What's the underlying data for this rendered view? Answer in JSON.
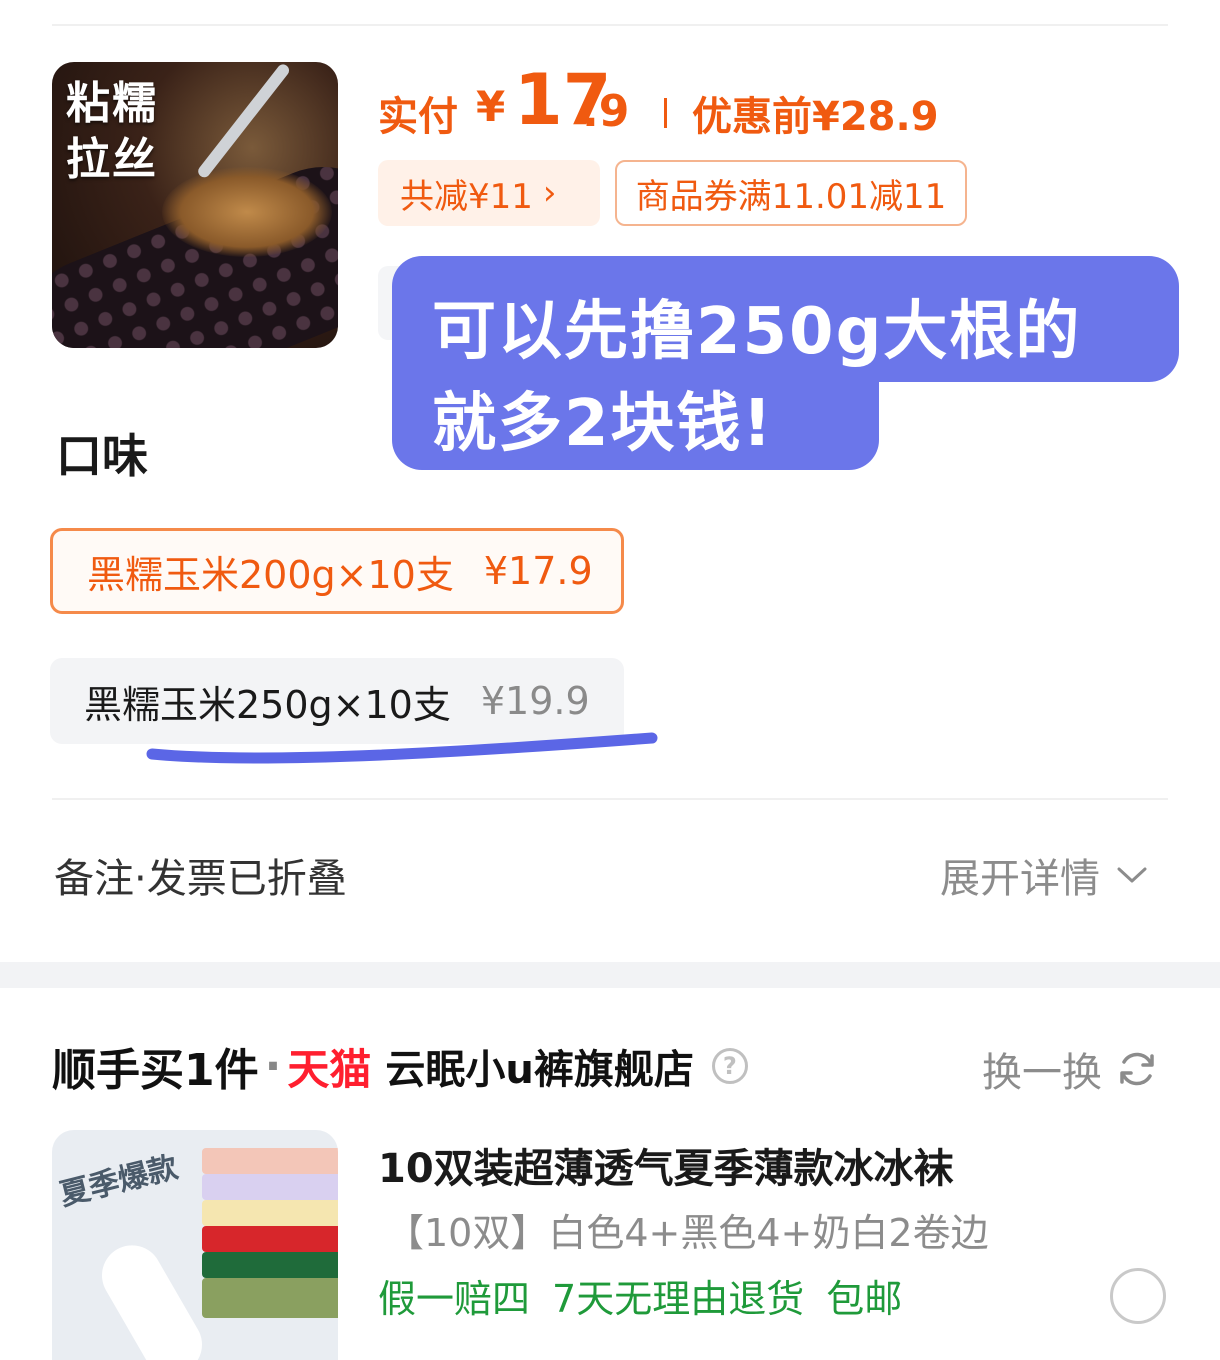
{
  "product": {
    "image_caption_line1": "粘糯",
    "image_caption_line2": "拉丝",
    "pay_label": "实付",
    "currency": "¥",
    "pay_int": "17",
    "pay_dec": ".9",
    "original_price_label": "优惠前¥28.9",
    "saved_chip": "共减¥11",
    "saved_chevron": "›",
    "coupon_chip": "商品券满11.01减11"
  },
  "annotation": {
    "line1": "可以先撸250g大根的",
    "line2": "就多2块钱!",
    "bubble_color": "#6b76ea",
    "underline_color": "#5b66e6"
  },
  "flavor": {
    "title": "口味",
    "options": [
      {
        "label": "黑糯玉米200g×10支",
        "price": "¥17.9",
        "selected": true
      },
      {
        "label": "黑糯玉米250g×10支",
        "price": "¥19.9",
        "selected": false
      }
    ]
  },
  "notes": {
    "label": "备注·发票已折叠",
    "expand_label": "展开详情",
    "expand_icon": "chevron-down-icon"
  },
  "addon": {
    "section_title": "顺手买1件",
    "dot": "·",
    "tmall": "天猫",
    "store": "云眠小u裤旗舰店",
    "help_icon": "?",
    "swap_label": "换一换",
    "swap_icon": "refresh-icon",
    "item": {
      "image_badge": "夏季爆款",
      "name": "10双装超薄透气夏季薄款冰冰袜",
      "variant": "【10双】白色4+黑色4+奶白2卷边",
      "tags": [
        "假一赔四",
        "7天无理由退货",
        "包邮"
      ]
    }
  },
  "colors": {
    "accent_orange": "#f05a10",
    "tmall_red": "#ff1f2f",
    "service_green": "#1f9a3a"
  }
}
